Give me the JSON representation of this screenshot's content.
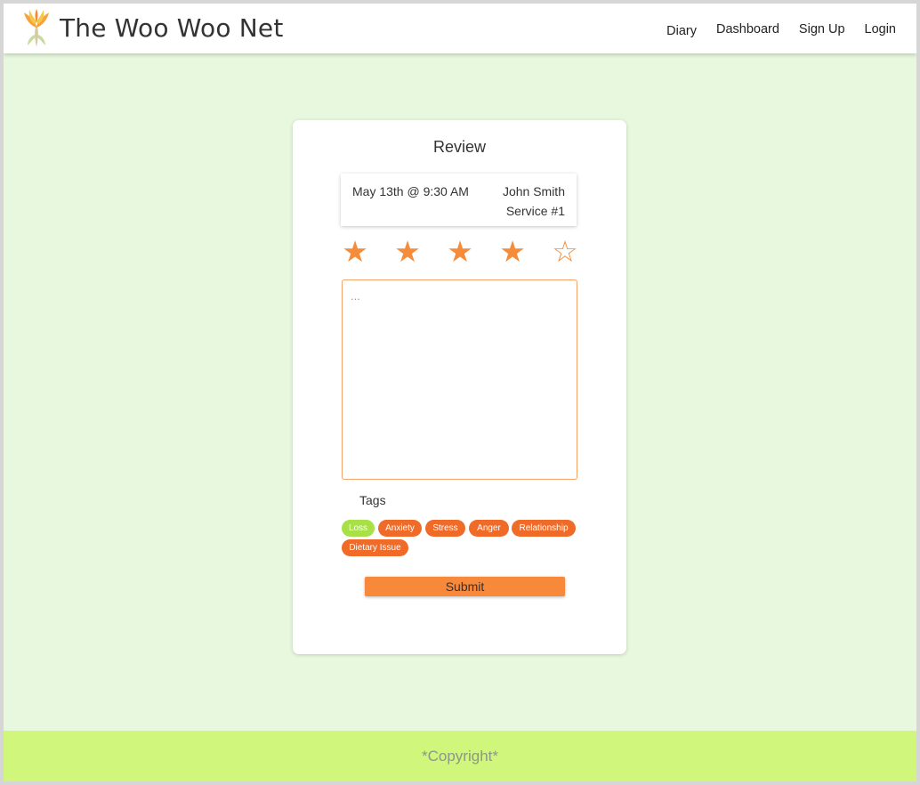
{
  "brand": {
    "name": "The Woo Woo Net",
    "logo_icon": "phoenix-flame-logo"
  },
  "nav": {
    "items": [
      "Diary",
      "Dashboard",
      "Sign Up",
      "Login"
    ]
  },
  "review_card": {
    "title": "Review",
    "appointment": {
      "date_time": "May 13th @ 9:30 AM",
      "practitioner": "John Smith",
      "service": "Service #1"
    },
    "rating": {
      "value": 4,
      "max": 5
    },
    "stars": [
      "★",
      "★",
      "★",
      "★",
      "☆"
    ],
    "review_text": {
      "value": "",
      "placeholder": "..."
    },
    "tags_label": "Tags",
    "tags": [
      {
        "label": "Loss",
        "color": "#a8e048"
      },
      {
        "label": "Anxiety",
        "color": "#f06a28"
      },
      {
        "label": "Stress",
        "color": "#f06a28"
      },
      {
        "label": "Anger",
        "color": "#f06a28"
      },
      {
        "label": "Relationship",
        "color": "#f06a28"
      },
      {
        "label": "Dietary Issue",
        "color": "#f06a28"
      }
    ],
    "submit_label": "Submit"
  },
  "footer": {
    "copyright": "*Copyright*"
  },
  "colors": {
    "page_background": "#e8f8df",
    "accent": "#f8893a",
    "footer_background": "#d0f67b"
  }
}
